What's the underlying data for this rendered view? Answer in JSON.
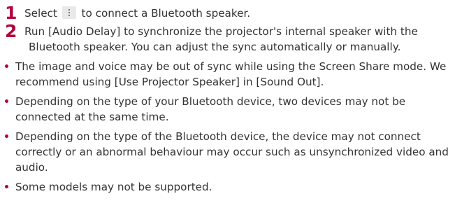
{
  "steps": [
    {
      "number": "1",
      "text_before": "Select",
      "text_after": "to connect a Bluetooth speaker."
    },
    {
      "number": "2",
      "line1": "Run [Audio Delay] to synchronize the projector's internal speaker with the",
      "line2": "Bluetooth speaker. You can adjust the sync automatically or manually."
    }
  ],
  "icons": {
    "menu": "more-vertical-icon"
  },
  "bullets": [
    {
      "line1": "The image and voice may be out of sync while using the Screen Share mode. We",
      "line2": "recommend using [Use Projector Speaker] in [Sound Out]."
    },
    {
      "line1": "Depending on the type of your Bluetooth device, two devices may not be",
      "line2": "connected at the same time."
    },
    {
      "line1": "Depending on the type of the Bluetooth device, the device may not connect",
      "line2": "correctly or an abnormal behaviour may occur such as unsynchronized video and",
      "line3": "audio."
    },
    {
      "line1": "Some models may not be supported."
    }
  ],
  "colors": {
    "accent": "#b5003d",
    "text": "#333333"
  }
}
